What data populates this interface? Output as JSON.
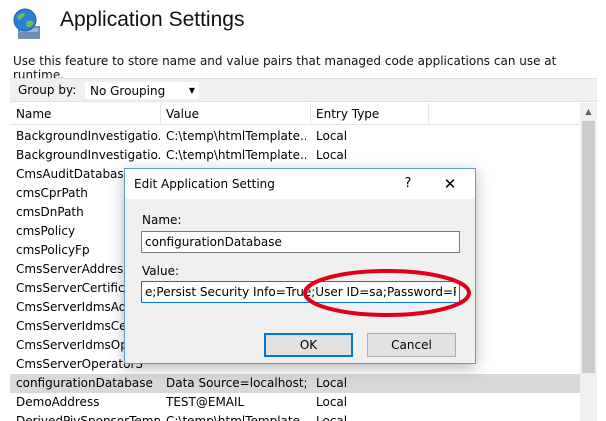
{
  "header": {
    "title": "Application Settings",
    "description": "Use this feature to store name and value pairs that managed code applications can use at runtime."
  },
  "toolbar": {
    "group_by_label": "Group by:",
    "group_by_value": "No Grouping"
  },
  "columns": {
    "name": "Name",
    "value": "Value",
    "type": "Entry Type"
  },
  "rows": [
    {
      "name": "BackgroundInvestigatio...",
      "value": "C:\\temp\\htmlTemplate...",
      "type": "Local"
    },
    {
      "name": "BackgroundInvestigatio...",
      "value": "C:\\temp\\htmlTemplate...",
      "type": "Local"
    },
    {
      "name": "CmsAuditDatabaseC",
      "value": "",
      "type": ""
    },
    {
      "name": "cmsCprPath",
      "value": "",
      "type": ""
    },
    {
      "name": "cmsDnPath",
      "value": "",
      "type": ""
    },
    {
      "name": "cmsPolicy",
      "value": "",
      "type": ""
    },
    {
      "name": "cmsPolicyFp",
      "value": "",
      "type": ""
    },
    {
      "name": "CmsServerAddress",
      "value": "",
      "type": ""
    },
    {
      "name": "CmsServerCertificate",
      "value": "",
      "type": ""
    },
    {
      "name": "CmsServerIdmsAddr",
      "value": "",
      "type": ""
    },
    {
      "name": "CmsServerIdmsCerti",
      "value": "",
      "type": ""
    },
    {
      "name": "CmsServerIdmsOper",
      "value": "",
      "type": ""
    },
    {
      "name": "CmsServerOperatorS",
      "value": "",
      "type": ""
    },
    {
      "name": "configurationDatabase",
      "value": "Data Source=localhost;I...",
      "type": "Local"
    },
    {
      "name": "DemoAddress",
      "value": "TEST@EMAIL",
      "type": "Local"
    },
    {
      "name": "DerivedPivSponsorTemp...",
      "value": "C:\\temp\\htmlTemplate...",
      "type": "Local"
    }
  ],
  "selected_row": 13,
  "dialog": {
    "title": "Edit Application Setting",
    "help": "?",
    "close": "✕",
    "name_label": "Name:",
    "name_value": "configurationDatabase",
    "value_label": "Value:",
    "value_value": "е;Persist Security Info=True;User ID=sa;Password=Password",
    "ok_label": "OK",
    "cancel_label": "Cancel"
  },
  "colors": {
    "accent": "#0078d7",
    "selected_row": "#d9d9d9",
    "annotation": "#e0001b"
  }
}
